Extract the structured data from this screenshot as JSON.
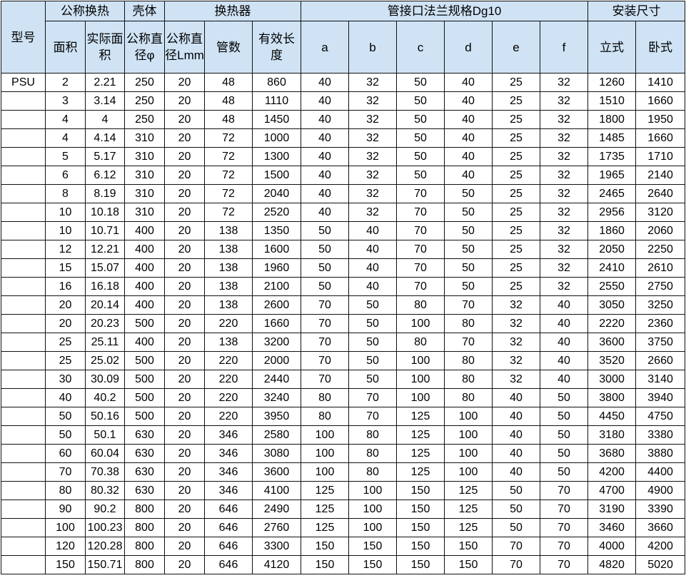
{
  "header": {
    "model": "型号",
    "group_area": "公称换热",
    "group_shell": "壳体",
    "group_exchanger": "换热器",
    "group_flange": "管接口法兰规格Dg10",
    "group_install": "安装尺寸",
    "area": "面积",
    "actual_area": "实际面积",
    "shell_diameter": "公称直径φ",
    "tube_diameter": "公称直径Lmm",
    "tube_count": "管数",
    "effective_length": "有效长度",
    "a": "a",
    "b": "b",
    "c": "c",
    "d": "d",
    "e": "e",
    "f": "f",
    "vertical": "立式",
    "horizontal": "卧式"
  },
  "rows": [
    [
      "PSU",
      "2",
      "2.21",
      "250",
      "20",
      "48",
      "860",
      "40",
      "32",
      "50",
      "40",
      "25",
      "32",
      "1260",
      "1410"
    ],
    [
      "",
      "3",
      "3.14",
      "250",
      "20",
      "48",
      "1110",
      "40",
      "32",
      "50",
      "40",
      "25",
      "32",
      "1510",
      "1660"
    ],
    [
      "",
      "4",
      "4",
      "250",
      "20",
      "48",
      "1450",
      "40",
      "32",
      "50",
      "40",
      "25",
      "32",
      "1800",
      "1950"
    ],
    [
      "",
      "4",
      "4.14",
      "310",
      "20",
      "72",
      "1000",
      "40",
      "32",
      "50",
      "40",
      "25",
      "32",
      "1485",
      "1660"
    ],
    [
      "",
      "5",
      "5.17",
      "310",
      "20",
      "72",
      "1300",
      "40",
      "32",
      "50",
      "40",
      "25",
      "32",
      "1735",
      "1710"
    ],
    [
      "",
      "6",
      "6.12",
      "310",
      "20",
      "72",
      "1500",
      "40",
      "32",
      "50",
      "40",
      "25",
      "32",
      "1965",
      "2140"
    ],
    [
      "",
      "8",
      "8.19",
      "310",
      "20",
      "72",
      "2040",
      "40",
      "32",
      "70",
      "50",
      "25",
      "32",
      "2465",
      "2640"
    ],
    [
      "",
      "10",
      "10.18",
      "310",
      "20",
      "72",
      "2520",
      "40",
      "32",
      "70",
      "50",
      "25",
      "32",
      "2956",
      "3120"
    ],
    [
      "",
      "10",
      "10.71",
      "400",
      "20",
      "138",
      "1350",
      "50",
      "40",
      "70",
      "50",
      "25",
      "32",
      "1860",
      "2060"
    ],
    [
      "",
      "12",
      "12.21",
      "400",
      "20",
      "138",
      "1600",
      "50",
      "40",
      "70",
      "50",
      "25",
      "32",
      "2050",
      "2250"
    ],
    [
      "",
      "15",
      "15.07",
      "400",
      "20",
      "138",
      "1960",
      "50",
      "40",
      "70",
      "50",
      "25",
      "32",
      "2410",
      "2610"
    ],
    [
      "",
      "16",
      "16.18",
      "400",
      "20",
      "138",
      "2100",
      "50",
      "40",
      "70",
      "50",
      "25",
      "32",
      "2550",
      "2750"
    ],
    [
      "",
      "20",
      "20.14",
      "400",
      "20",
      "138",
      "2600",
      "70",
      "50",
      "80",
      "70",
      "32",
      "40",
      "3050",
      "3250"
    ],
    [
      "",
      "20",
      "20.23",
      "500",
      "20",
      "220",
      "1660",
      "70",
      "50",
      "100",
      "80",
      "32",
      "40",
      "2220",
      "2360"
    ],
    [
      "",
      "25",
      "25.11",
      "400",
      "20",
      "138",
      "3200",
      "70",
      "50",
      "80",
      "70",
      "32",
      "40",
      "3600",
      "3750"
    ],
    [
      "",
      "25",
      "25.02",
      "500",
      "20",
      "220",
      "2000",
      "70",
      "50",
      "100",
      "80",
      "32",
      "40",
      "3520",
      "2660"
    ],
    [
      "",
      "30",
      "30.09",
      "500",
      "20",
      "220",
      "2440",
      "70",
      "50",
      "100",
      "80",
      "32",
      "40",
      "3000",
      "3140"
    ],
    [
      "",
      "40",
      "40.2",
      "500",
      "20",
      "220",
      "3240",
      "80",
      "70",
      "100",
      "80",
      "40",
      "50",
      "3800",
      "3940"
    ],
    [
      "",
      "50",
      "50.16",
      "500",
      "20",
      "220",
      "3950",
      "80",
      "70",
      "125",
      "100",
      "40",
      "50",
      "4450",
      "4750"
    ],
    [
      "",
      "50",
      "50.1",
      "630",
      "20",
      "346",
      "2580",
      "100",
      "80",
      "125",
      "100",
      "40",
      "50",
      "3180",
      "3380"
    ],
    [
      "",
      "60",
      "60.04",
      "630",
      "20",
      "346",
      "3080",
      "100",
      "80",
      "125",
      "100",
      "40",
      "50",
      "3680",
      "3880"
    ],
    [
      "",
      "70",
      "70.38",
      "630",
      "20",
      "346",
      "3600",
      "100",
      "80",
      "125",
      "100",
      "40",
      "50",
      "4200",
      "4400"
    ],
    [
      "",
      "80",
      "80.32",
      "630",
      "20",
      "346",
      "4100",
      "125",
      "100",
      "150",
      "125",
      "50",
      "70",
      "4700",
      "4900"
    ],
    [
      "",
      "90",
      "90.2",
      "800",
      "20",
      "646",
      "2490",
      "125",
      "100",
      "150",
      "125",
      "50",
      "70",
      "3190",
      "3390"
    ],
    [
      "",
      "100",
      "100.23",
      "800",
      "20",
      "646",
      "2760",
      "125",
      "100",
      "150",
      "125",
      "50",
      "70",
      "3460",
      "3660"
    ],
    [
      "",
      "120",
      "120.28",
      "800",
      "20",
      "646",
      "3300",
      "150",
      "150",
      "150",
      "150",
      "70",
      "70",
      "4000",
      "4200"
    ],
    [
      "",
      "150",
      "150.71",
      "800",
      "20",
      "646",
      "4120",
      "150",
      "150",
      "150",
      "150",
      "70",
      "70",
      "4820",
      "5020"
    ]
  ],
  "colors": {
    "header_background": "#cfe3f5",
    "border": "#111111",
    "text": "#000000"
  }
}
